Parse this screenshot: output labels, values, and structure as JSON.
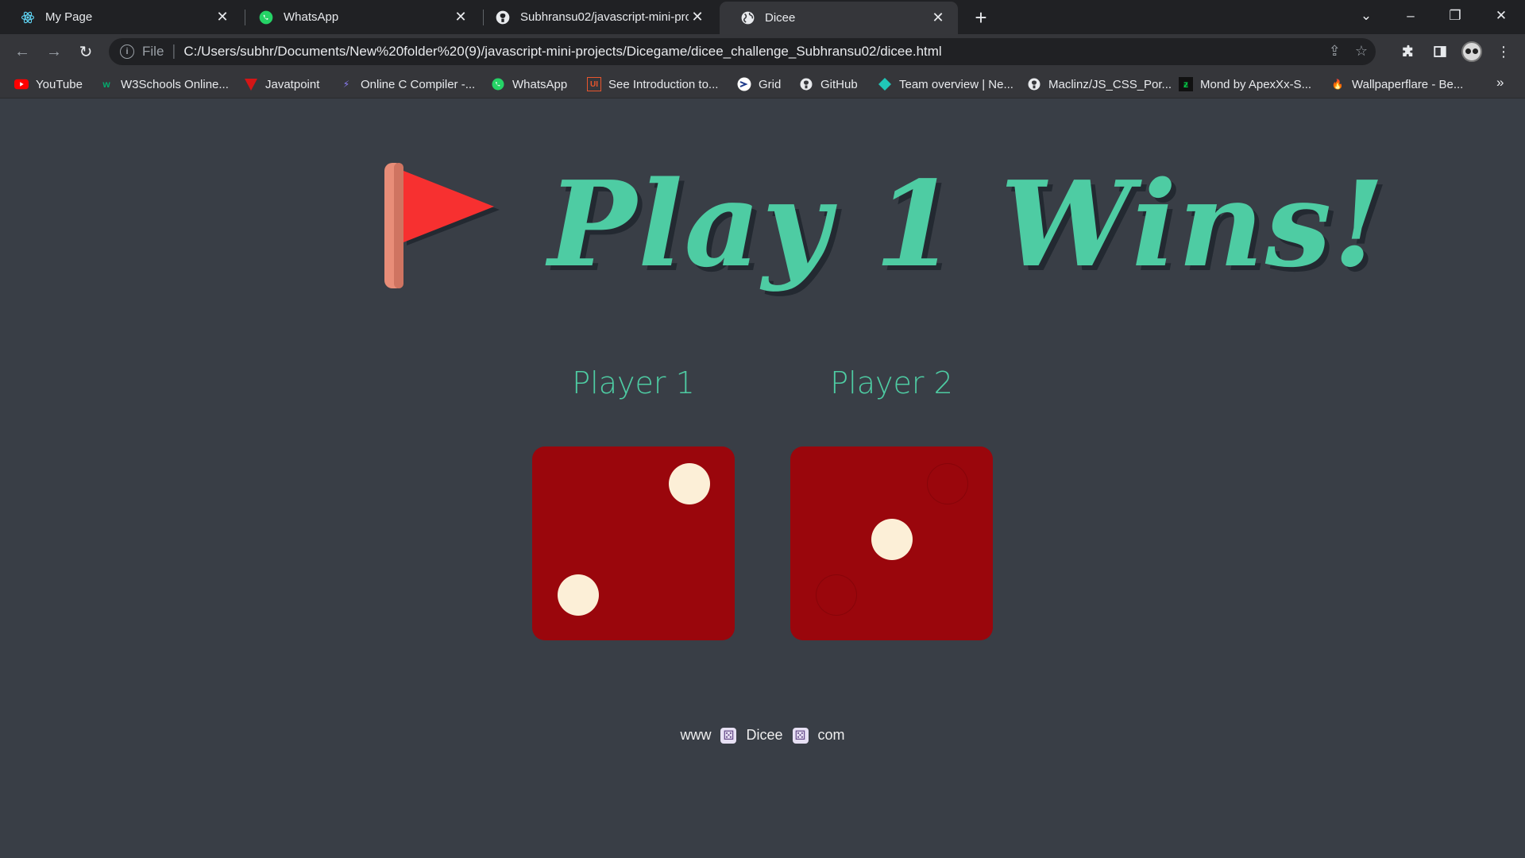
{
  "browser": {
    "tabs": [
      {
        "label": "My Page",
        "icon": "react-icon",
        "active": false
      },
      {
        "label": "WhatsApp",
        "icon": "whatsapp-icon",
        "active": false
      },
      {
        "label": "Subhransu02/javascript-mini-pro",
        "icon": "github-icon",
        "active": false
      },
      {
        "label": "Dicee",
        "icon": "globe-icon",
        "active": true
      }
    ],
    "address": {
      "scheme_label": "File",
      "url": "C:/Users/subhr/Documents/New%20folder%20(9)/javascript-mini-projects/Dicegame/dicee_challenge_Subhransu02/dicee.html"
    },
    "bookmarks": [
      {
        "label": "YouTube",
        "icon": "youtube-icon",
        "color": "#ff0000"
      },
      {
        "label": "W3Schools Online...",
        "icon": "w3schools-icon",
        "color": "#04aa6d"
      },
      {
        "label": "Javatpoint",
        "icon": "javatpoint-icon",
        "color": "#d41616"
      },
      {
        "label": "Online C Compiler -...",
        "icon": "bolt-icon",
        "color": "#6c5ce7"
      },
      {
        "label": "WhatsApp",
        "icon": "whatsapp-icon",
        "color": "#25d366"
      },
      {
        "label": "See Introduction to...",
        "icon": "ui-icon",
        "color": "#e8552d"
      },
      {
        "label": "Grid",
        "icon": "grid-icon",
        "color": "#3b82f6"
      },
      {
        "label": "GitHub",
        "icon": "github-icon",
        "color": "#ffffff"
      },
      {
        "label": "Team overview | Ne...",
        "icon": "netlify-icon",
        "color": "#20c6b7"
      },
      {
        "label": "Maclinz/JS_CSS_Por...",
        "icon": "github-icon",
        "color": "#ffffff"
      },
      {
        "label": "Mond by ApexXx-S...",
        "icon": "deviantart-icon",
        "color": "#05cc47"
      },
      {
        "label": "Wallpaperflare - Be...",
        "icon": "flame-icon",
        "color": "#e74c3c"
      }
    ]
  },
  "game": {
    "headline": "Play 1 Wins!",
    "players": [
      {
        "label": "Player 1",
        "die_value": 2
      },
      {
        "label": "Player 2",
        "die_value": 1
      }
    ],
    "footer": {
      "prefix": "www",
      "site": "Dicee",
      "suffix": "com"
    },
    "colors": {
      "accent": "#4ecca3",
      "background": "#393e46",
      "die": "#9a060c",
      "pip": "#fcefd7",
      "flag": "#f73030"
    }
  }
}
